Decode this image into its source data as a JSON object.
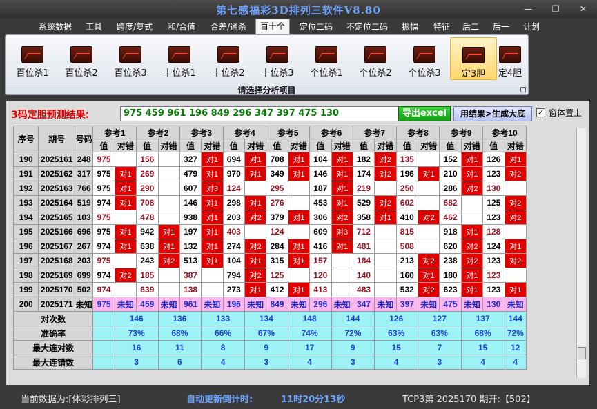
{
  "window": {
    "title": "第七感福彩3D排列三软件V8.80",
    "minimize": "—",
    "restore": "❐",
    "close": "✕"
  },
  "menu": [
    "系统数据",
    "工具",
    "跨度/复式",
    "和/合值",
    "合差/通杀",
    "百十个",
    "定位二码",
    "不定位二码",
    "振幅",
    "特征",
    "后二",
    "后一",
    "计划"
  ],
  "menu_active": "百十个",
  "tools": [
    "百位杀1",
    "百位杀2",
    "百位杀3",
    "十位杀1",
    "十位杀2",
    "十位杀3",
    "个位杀1",
    "个位杀2",
    "个位杀3",
    "定3胆",
    "定4胆"
  ],
  "tool_selected": "定3胆",
  "ribbon_group_label": "请选择分析项目",
  "prediction": {
    "label": "3码定胆预测结果:",
    "value": "975 459 961 196 849 296 347 397 475 130",
    "export_button": "导出excel",
    "generate_button": "用结果>生成大底",
    "ontop_checkbox": "✓",
    "ontop_label": "窗体置上"
  },
  "table": {
    "headers": {
      "index": "序号",
      "period": "期号",
      "number": "号码",
      "value": "值",
      "hit": "对错"
    },
    "refs": [
      "参考1",
      "参考2",
      "参考3",
      "参考4",
      "参考5",
      "参考6",
      "参考7",
      "参考8",
      "参考9",
      "参考10"
    ],
    "rows": [
      {
        "i": "190",
        "p": "2025161",
        "n": "248",
        "c": [
          [
            "975",
            "",
            0
          ],
          [
            "156",
            "",
            0
          ],
          [
            "327",
            "对1",
            1
          ],
          [
            "694",
            "对1",
            1
          ],
          [
            "708",
            "对1",
            1
          ],
          [
            "104",
            "对1",
            1
          ],
          [
            "182",
            "对2",
            1
          ],
          [
            "135",
            "",
            0
          ],
          [
            "152",
            "对1",
            1
          ],
          [
            "126",
            "对1",
            1
          ]
        ]
      },
      {
        "i": "191",
        "p": "2025162",
        "n": "317",
        "c": [
          [
            "975",
            "对1",
            1
          ],
          [
            "269",
            "",
            0
          ],
          [
            "479",
            "对1",
            1
          ],
          [
            "970",
            "对1",
            1
          ],
          [
            "349",
            "对1",
            1
          ],
          [
            "146",
            "对1",
            1
          ],
          [
            "174",
            "对2",
            1
          ],
          [
            "196",
            "对1",
            1
          ],
          [
            "210",
            "对1",
            1
          ],
          [
            "123",
            "对2",
            1
          ]
        ]
      },
      {
        "i": "192",
        "p": "2025163",
        "n": "766",
        "c": [
          [
            "975",
            "对1",
            1
          ],
          [
            "290",
            "",
            0
          ],
          [
            "607",
            "对3",
            1
          ],
          [
            "124",
            "",
            0
          ],
          [
            "295",
            "",
            0
          ],
          [
            "187",
            "对1",
            1
          ],
          [
            "219",
            "",
            0
          ],
          [
            "250",
            "",
            0
          ],
          [
            "286",
            "对2",
            1
          ],
          [
            "130",
            "",
            0
          ]
        ]
      },
      {
        "i": "193",
        "p": "2025164",
        "n": "519",
        "c": [
          [
            "974",
            "对1",
            1
          ],
          [
            "708",
            "",
            0
          ],
          [
            "146",
            "对1",
            1
          ],
          [
            "298",
            "对1",
            1
          ],
          [
            "276",
            "",
            0
          ],
          [
            "453",
            "对1",
            1
          ],
          [
            "529",
            "对2",
            1
          ],
          [
            "602",
            "",
            0
          ],
          [
            "682",
            "",
            0
          ],
          [
            "125",
            "对2",
            1
          ]
        ]
      },
      {
        "i": "194",
        "p": "2025165",
        "n": "103",
        "c": [
          [
            "975",
            "",
            0
          ],
          [
            "478",
            "",
            0
          ],
          [
            "938",
            "对1",
            1
          ],
          [
            "203",
            "对2",
            1
          ],
          [
            "379",
            "对1",
            1
          ],
          [
            "306",
            "对2",
            1
          ],
          [
            "358",
            "对1",
            1
          ],
          [
            "410",
            "对2",
            1
          ],
          [
            "462",
            "",
            0
          ],
          [
            "123",
            "对2",
            1
          ]
        ]
      },
      {
        "i": "195",
        "p": "2025166",
        "n": "696",
        "c": [
          [
            "975",
            "对1",
            1
          ],
          [
            "942",
            "对1",
            1
          ],
          [
            "197",
            "对1",
            1
          ],
          [
            "403",
            "",
            0
          ],
          [
            "124",
            "",
            0
          ],
          [
            "609",
            "对3",
            1
          ],
          [
            "712",
            "",
            0
          ],
          [
            "815",
            "",
            0
          ],
          [
            "918",
            "对1",
            1
          ],
          [
            "128",
            "",
            0
          ]
        ]
      },
      {
        "i": "196",
        "p": "2025167",
        "n": "267",
        "c": [
          [
            "974",
            "对1",
            1
          ],
          [
            "638",
            "对1",
            1
          ],
          [
            "132",
            "对1",
            1
          ],
          [
            "274",
            "对2",
            1
          ],
          [
            "284",
            "对1",
            1
          ],
          [
            "416",
            "对1",
            1
          ],
          [
            "481",
            "",
            0
          ],
          [
            "508",
            "",
            0
          ],
          [
            "620",
            "对2",
            1
          ],
          [
            "124",
            "对1",
            1
          ]
        ]
      },
      {
        "i": "197",
        "p": "2025168",
        "n": "203",
        "c": [
          [
            "975",
            "",
            0
          ],
          [
            "243",
            "对2",
            1
          ],
          [
            "513",
            "对1",
            1
          ],
          [
            "104",
            "对1",
            1
          ],
          [
            "315",
            "对1",
            1
          ],
          [
            "157",
            "",
            0
          ],
          [
            "184",
            "",
            0
          ],
          [
            "213",
            "对2",
            1
          ],
          [
            "238",
            "对2",
            1
          ],
          [
            "123",
            "对2",
            1
          ]
        ]
      },
      {
        "i": "198",
        "p": "2025169",
        "n": "699",
        "c": [
          [
            "974",
            "对2",
            1
          ],
          [
            "185",
            "",
            0
          ],
          [
            "387",
            "",
            0
          ],
          [
            "794",
            "对2",
            1
          ],
          [
            "125",
            "",
            0
          ],
          [
            "120",
            "",
            0
          ],
          [
            "140",
            "",
            0
          ],
          [
            "160",
            "对1",
            1
          ],
          [
            "180",
            "对1",
            1
          ],
          [
            "123",
            "",
            0
          ]
        ]
      },
      {
        "i": "199",
        "p": "2025170",
        "n": "502",
        "c": [
          [
            "974",
            "",
            0
          ],
          [
            "639",
            "",
            0
          ],
          [
            "138",
            "",
            0
          ],
          [
            "273",
            "对1",
            1
          ],
          [
            "412",
            "对1",
            1
          ],
          [
            "413",
            "",
            0
          ],
          [
            "483",
            "",
            0
          ],
          [
            "532",
            "对2",
            1
          ],
          [
            "623",
            "对1",
            1
          ],
          [
            "123",
            "对1",
            1
          ]
        ]
      }
    ],
    "pending": {
      "i": "200",
      "p": "2025171",
      "n": "未知",
      "vals": [
        "975",
        "459",
        "961",
        "196",
        "849",
        "296",
        "347",
        "397",
        "475",
        "130"
      ],
      "hit": "未知"
    },
    "stats": [
      {
        "label": "对次数",
        "vals": [
          "146",
          "136",
          "133",
          "134",
          "148",
          "144",
          "126",
          "127",
          "137",
          "144"
        ]
      },
      {
        "label": "准确率",
        "vals": [
          "73%",
          "68%",
          "66%",
          "67%",
          "74%",
          "72%",
          "63%",
          "63%",
          "68%",
          "72%"
        ]
      },
      {
        "label": "最大连对数",
        "vals": [
          "16",
          "11",
          "8",
          "9",
          "17",
          "9",
          "15",
          "7",
          "15",
          "12"
        ]
      },
      {
        "label": "最大连错数",
        "vals": [
          "3",
          "6",
          "4",
          "3",
          "4",
          "3",
          "4",
          "3",
          "4",
          "4"
        ]
      }
    ]
  },
  "status": {
    "data_source": "当前数据为:[体彩排列三]",
    "countdown_label": "自动更新倒计时:",
    "countdown": "11时20分13秒",
    "latest": "TCP3第 2025170 期开:【502】"
  },
  "colors": {
    "hit": "#e00000",
    "stat_bg": "#9df2f6",
    "pending_bg": "#ffb6f0",
    "title": "#6ea4ff"
  }
}
